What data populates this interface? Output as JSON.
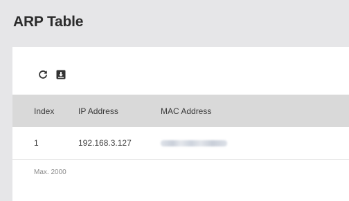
{
  "page": {
    "title": "ARP Table"
  },
  "toolbar": {
    "refresh_icon": "refresh-icon",
    "export_icon": "export-icon"
  },
  "table": {
    "columns": [
      "Index",
      "IP Address",
      "MAC Address"
    ],
    "rows": [
      {
        "index": "1",
        "ip": "192.168.3.127",
        "mac": ""
      }
    ]
  },
  "footer": {
    "max_note": "Max. 2000"
  },
  "colors": {
    "background": "#e6e6e8",
    "card": "#ffffff",
    "header_row": "#d9d9d9",
    "icon": "#333333"
  }
}
